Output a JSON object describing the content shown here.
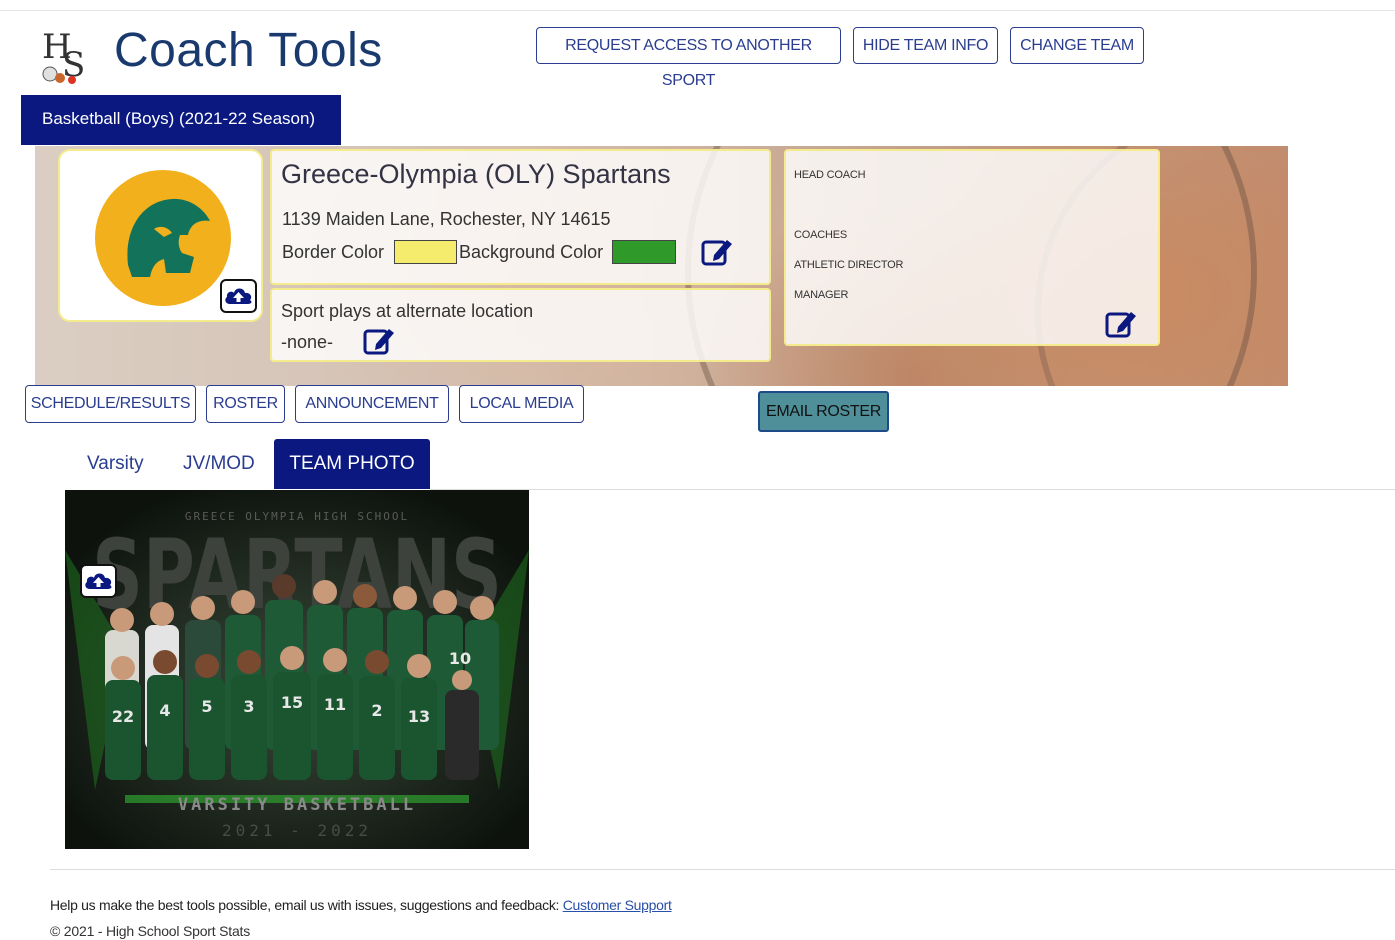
{
  "header": {
    "title": "Coach Tools",
    "buttons": {
      "request_access": "REQUEST ACCESS TO ANOTHER SPORT",
      "hide_team_info": "HIDE TEAM INFO",
      "change_team": "CHANGE TEAM"
    }
  },
  "season_tab": "Basketball (Boys) (2021-22 Season)",
  "team": {
    "name": "Greece-Olympia (OLY) Spartans",
    "address": "1139 Maiden Lane, Rochester, NY 14615",
    "border_color_label": "Border Color",
    "background_color_label": "Background Color",
    "border_color": "#f5ec6e",
    "background_color": "#2f9a2a",
    "logo_colors": {
      "circle": "#f2b01c",
      "helmet": "#13735a"
    },
    "alternate_location_label": "Sport plays at alternate location",
    "alternate_location_value": "-none-"
  },
  "staff": {
    "head_coach": "HEAD COACH",
    "coaches": "COACHES",
    "athletic_director": "ATHLETIC DIRECTOR",
    "manager": "MANAGER"
  },
  "nav": {
    "schedule": "SCHEDULE/RESULTS",
    "roster": "ROSTER",
    "announcement": "ANNOUNCEMENT",
    "local_media": "LOCAL MEDIA",
    "email_roster": "EMAIL ROSTER"
  },
  "tabs": {
    "varsity": "Varsity",
    "jv_mod": "JV/MOD",
    "team_photo": "TEAM PHOTO"
  },
  "photo": {
    "school_text": "GREECE OLYMPIA HIGH SCHOOL",
    "big_text": "SPARTANS",
    "caption": "VARSITY BASKETBALL",
    "years": "2021 - 2022",
    "jersey_numbers": [
      "22",
      "4",
      "5",
      "3",
      "15",
      "11",
      "2",
      "13",
      "10"
    ]
  },
  "footer": {
    "text": "Help us make the best tools possible, email us with issues, suggestions and feedback:",
    "link": "Customer Support",
    "copyright": "© 2021 - High School Sport Stats"
  },
  "icons": {
    "upload": "cloud-upload-icon",
    "edit": "edit-icon"
  }
}
